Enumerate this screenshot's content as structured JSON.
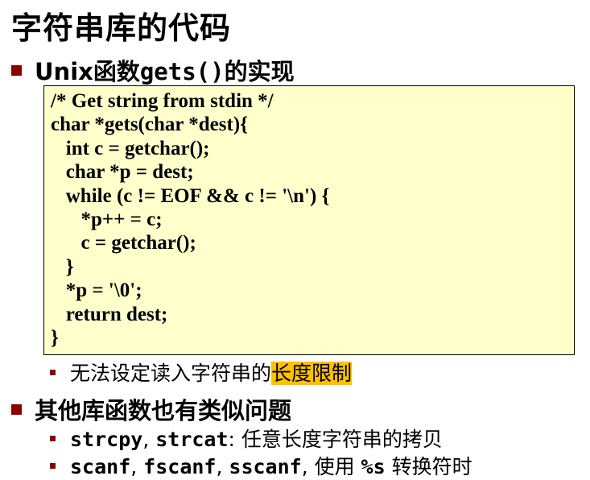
{
  "slide": {
    "title": "字符串库的代码",
    "bullet1": {
      "prefix": "Unix函数",
      "code": "gets()",
      "suffix": "的实现"
    },
    "code_lines": [
      "/* Get string from stdin */",
      "char *gets(char *dest){",
      "   int c = getchar();",
      "   char *p = dest;",
      "   while (c != EOF && c != '\\n') {",
      "      *p++ = c;",
      "      c = getchar();",
      "   }",
      "   *p = '\\0';",
      "   return dest;",
      "}"
    ],
    "sub1": {
      "text": "无法设定读入字符串的",
      "highlight": "长度限制"
    },
    "bullet2": {
      "text": "其他库函数也有类似问题"
    },
    "sub2": {
      "code1": "strcpy",
      "sep": ", ",
      "code2": "strcat",
      "text": ": 任意长度字符串的拷贝"
    },
    "sub3": {
      "code1": "scanf",
      "sep1": ", ",
      "code2": "fscanf",
      "sep2": ", ",
      "code3": "sscanf",
      "text1": ", 使用 ",
      "code4": "%s",
      "text2": " 转换符时"
    },
    "colors": {
      "bullet": "#8b0000",
      "code_background": "#ffffcc",
      "highlight": "#ffc000"
    }
  }
}
